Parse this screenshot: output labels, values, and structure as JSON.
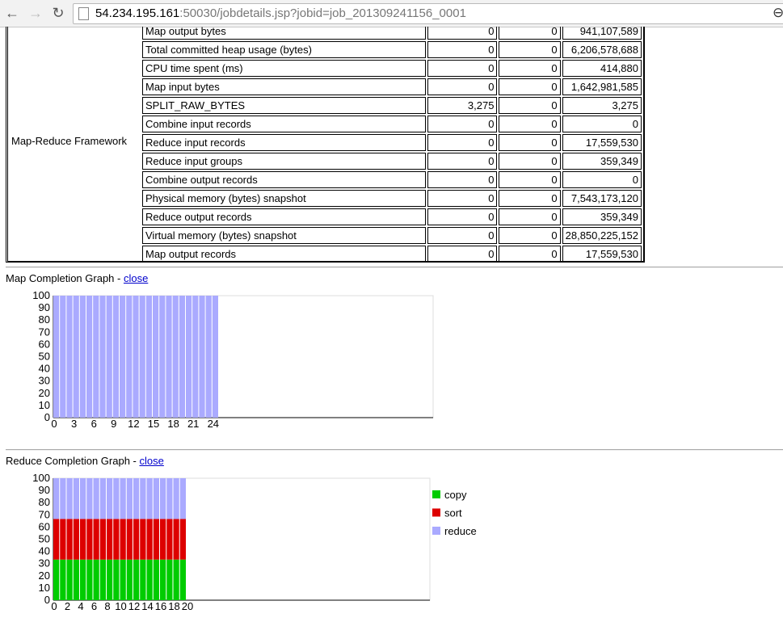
{
  "browser": {
    "url_host": "54.234.195.161",
    "url_rest": ":50030/jobdetails.jsp?jobid=job_201309241156_0001"
  },
  "counters": {
    "group": "Map-Reduce Framework",
    "rows": [
      {
        "name": "Map output bytes",
        "map": "0",
        "reduce": "0",
        "total": "941,107,589"
      },
      {
        "name": "Total committed heap usage (bytes)",
        "map": "0",
        "reduce": "0",
        "total": "6,206,578,688"
      },
      {
        "name": "CPU time spent (ms)",
        "map": "0",
        "reduce": "0",
        "total": "414,880"
      },
      {
        "name": "Map input bytes",
        "map": "0",
        "reduce": "0",
        "total": "1,642,981,585"
      },
      {
        "name": "SPLIT_RAW_BYTES",
        "map": "3,275",
        "reduce": "0",
        "total": "3,275"
      },
      {
        "name": "Combine input records",
        "map": "0",
        "reduce": "0",
        "total": "0"
      },
      {
        "name": "Reduce input records",
        "map": "0",
        "reduce": "0",
        "total": "17,559,530"
      },
      {
        "name": "Reduce input groups",
        "map": "0",
        "reduce": "0",
        "total": "359,349"
      },
      {
        "name": "Combine output records",
        "map": "0",
        "reduce": "0",
        "total": "0"
      },
      {
        "name": "Physical memory (bytes) snapshot",
        "map": "0",
        "reduce": "0",
        "total": "7,543,173,120"
      },
      {
        "name": "Reduce output records",
        "map": "0",
        "reduce": "0",
        "total": "359,349"
      },
      {
        "name": "Virtual memory (bytes) snapshot",
        "map": "0",
        "reduce": "0",
        "total": "28,850,225,152"
      },
      {
        "name": "Map output records",
        "map": "0",
        "reduce": "0",
        "total": "17,559,530"
      }
    ]
  },
  "map_graph": {
    "title": "Map Completion Graph - ",
    "close_label": "close"
  },
  "reduce_graph": {
    "title": "Reduce Completion Graph - ",
    "close_label": "close"
  },
  "chart_data": [
    {
      "type": "bar",
      "ylim": [
        0,
        100
      ],
      "yticks": [
        "100",
        "90",
        "80",
        "70",
        "60",
        "50",
        "40",
        "30",
        "20",
        "10",
        "0"
      ],
      "xticks": [
        "0",
        "3",
        "6",
        "9",
        "12",
        "15",
        "18",
        "21",
        "24"
      ],
      "task_count": 25,
      "series": [
        {
          "values": [
            100,
            100,
            100,
            100,
            100,
            100,
            100,
            100,
            100,
            100,
            100,
            100,
            100,
            100,
            100,
            100,
            100,
            100,
            100,
            100,
            100,
            100,
            100,
            100,
            100
          ],
          "color": "#aaaaff"
        }
      ]
    },
    {
      "type": "bar",
      "stacked": true,
      "ylim": [
        0,
        100
      ],
      "yticks": [
        "100",
        "90",
        "80",
        "70",
        "60",
        "50",
        "40",
        "30",
        "20",
        "10",
        "0"
      ],
      "xticks": [
        "0",
        "2",
        "4",
        "6",
        "8",
        "10",
        "12",
        "14",
        "16",
        "18",
        "20"
      ],
      "task_count": 20,
      "legend": "right",
      "series": [
        {
          "name": "copy",
          "color": "#00cc00",
          "values": [
            33.3,
            33.3,
            33.3,
            33.3,
            33.3,
            33.3,
            33.3,
            33.3,
            33.3,
            33.3,
            33.3,
            33.3,
            33.3,
            33.3,
            33.3,
            33.3,
            33.3,
            33.3,
            33.3,
            33.3
          ]
        },
        {
          "name": "sort",
          "color": "#dd0000",
          "values": [
            33.3,
            33.3,
            33.3,
            33.3,
            33.3,
            33.3,
            33.3,
            33.3,
            33.3,
            33.3,
            33.3,
            33.3,
            33.3,
            33.3,
            33.3,
            33.3,
            33.3,
            33.3,
            33.3,
            33.3
          ]
        },
        {
          "name": "reduce",
          "color": "#aaaaff",
          "values": [
            33.4,
            33.4,
            33.4,
            33.4,
            33.4,
            33.4,
            33.4,
            33.4,
            33.4,
            33.4,
            33.4,
            33.4,
            33.4,
            33.4,
            33.4,
            33.4,
            33.4,
            33.4,
            33.4,
            33.4
          ]
        }
      ]
    }
  ]
}
